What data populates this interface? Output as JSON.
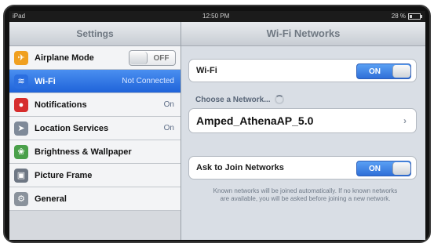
{
  "status_bar": {
    "device": "iPad",
    "time": "12:50 PM",
    "battery": "28 %"
  },
  "left_pane": {
    "title": "Settings",
    "items": [
      {
        "label": "Airplane Mode",
        "value": "OFF",
        "icon": "airplane-icon",
        "color": "#f0a020"
      },
      {
        "label": "Wi-Fi",
        "value": "Not Connected",
        "icon": "wifi-icon",
        "color": "#2b6fe0"
      },
      {
        "label": "Notifications",
        "value": "On",
        "icon": "notifications-icon",
        "color": "#d62d2d"
      },
      {
        "label": "Location Services",
        "value": "On",
        "icon": "location-icon",
        "color": "#7f8a99"
      },
      {
        "label": "Brightness & Wallpaper",
        "value": "",
        "icon": "brightness-wallpaper-icon",
        "color": "#4aa04a"
      },
      {
        "label": "Picture Frame",
        "value": "",
        "icon": "picture-frame-icon",
        "color": "#6e7784"
      },
      {
        "label": "General",
        "value": "",
        "icon": "gear-icon",
        "color": "#8a929c"
      }
    ]
  },
  "right_pane": {
    "title": "Wi-Fi Networks",
    "wifi": {
      "label": "Wi-Fi",
      "toggle": "ON"
    },
    "choose_network": "Choose a Network...",
    "network": {
      "name": "Amped_AthenaAP_5.0"
    },
    "ask_join": {
      "label": "Ask to Join Networks",
      "toggle": "ON"
    },
    "footer": "Known networks will be joined automatically. If no known networks are available, you will be asked before joining a new network."
  },
  "colors": {
    "selected_row": "#2f75e6",
    "toggle_on": "#3a7ee2"
  }
}
